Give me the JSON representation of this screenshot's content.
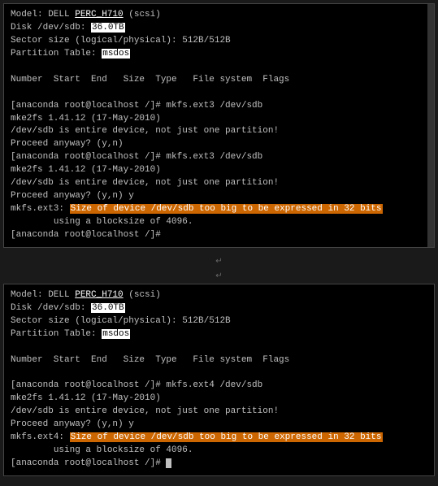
{
  "panels": [
    {
      "id": "panel-top",
      "lines": [
        {
          "id": "l1",
          "parts": [
            {
              "text": "Model: DELL ",
              "style": "text-normal"
            },
            {
              "text": "PERC_H710",
              "style": "text-white underline"
            },
            {
              "text": " (scsi)",
              "style": "text-normal"
            }
          ]
        },
        {
          "id": "l2",
          "parts": [
            {
              "text": "Disk /dev/sdb: ",
              "style": "text-normal"
            },
            {
              "text": "36.0TB",
              "style": "highlight-box"
            }
          ]
        },
        {
          "id": "l3",
          "parts": [
            {
              "text": "Sector size (logical/physical): 512B/512B",
              "style": "text-normal"
            }
          ]
        },
        {
          "id": "l4",
          "parts": [
            {
              "text": "Partition Table: ",
              "style": "text-normal"
            },
            {
              "text": "msdos",
              "style": "highlight-box"
            }
          ]
        },
        {
          "id": "l5",
          "parts": [
            {
              "text": "",
              "style": "text-normal"
            }
          ]
        },
        {
          "id": "l6",
          "parts": [
            {
              "text": "Number  Start  End   Size  Type   File system  Flags",
              "style": "text-normal"
            }
          ]
        },
        {
          "id": "l7",
          "parts": [
            {
              "text": "",
              "style": "text-normal"
            }
          ]
        },
        {
          "id": "l8",
          "parts": [
            {
              "text": "[anaconda root@localhost /]# mkfs.ext3 /dev/sdb",
              "style": "text-normal"
            }
          ]
        },
        {
          "id": "l9",
          "parts": [
            {
              "text": "mke2fs 1.41.12 (17-May-2010)",
              "style": "text-normal"
            }
          ]
        },
        {
          "id": "l10",
          "parts": [
            {
              "text": "/dev/sdb is entire device, not just one partition!",
              "style": "text-normal"
            }
          ]
        },
        {
          "id": "l11",
          "parts": [
            {
              "text": "Proceed anyway? (y,n)",
              "style": "text-normal"
            }
          ]
        },
        {
          "id": "l12",
          "parts": [
            {
              "text": "[anaconda root@localhost /]# mkfs.ext3 /dev/sdb",
              "style": "text-normal"
            }
          ]
        },
        {
          "id": "l13",
          "parts": [
            {
              "text": "mke2fs 1.41.12 (17-May-2010)",
              "style": "text-normal"
            }
          ]
        },
        {
          "id": "l14",
          "parts": [
            {
              "text": "/dev/sdb is entire device, not just one partition!",
              "style": "text-normal"
            }
          ]
        },
        {
          "id": "l15",
          "parts": [
            {
              "text": "Proceed anyway? (y,n) y",
              "style": "text-normal"
            }
          ]
        },
        {
          "id": "l16",
          "parts": [
            {
              "text": "mkfs.ext3: ",
              "style": "text-normal"
            },
            {
              "text": "Size of device /dev/sdb too big to be expressed in 32 bits",
              "style": "highlight-orange"
            }
          ]
        },
        {
          "id": "l17",
          "parts": [
            {
              "text": "        using a blocksize of 4096.",
              "style": "text-normal"
            }
          ]
        },
        {
          "id": "l18",
          "parts": [
            {
              "text": "[anaconda root@localhost /]#",
              "style": "text-normal"
            }
          ]
        }
      ]
    },
    {
      "id": "panel-bottom",
      "lines": [
        {
          "id": "b1",
          "parts": [
            {
              "text": "Model: DELL ",
              "style": "text-normal"
            },
            {
              "text": "PERC_H710",
              "style": "text-white underline"
            },
            {
              "text": " (scsi)",
              "style": "text-normal"
            }
          ]
        },
        {
          "id": "b2",
          "parts": [
            {
              "text": "Disk /dev/sdb: ",
              "style": "text-normal"
            },
            {
              "text": "36.0TB",
              "style": "highlight-box"
            }
          ]
        },
        {
          "id": "b3",
          "parts": [
            {
              "text": "Sector size (logical/physical): 512B/512B",
              "style": "text-normal"
            }
          ]
        },
        {
          "id": "b4",
          "parts": [
            {
              "text": "Partition Table: ",
              "style": "text-normal"
            },
            {
              "text": "msdos",
              "style": "highlight-box"
            }
          ]
        },
        {
          "id": "b5",
          "parts": [
            {
              "text": "",
              "style": "text-normal"
            }
          ]
        },
        {
          "id": "b6",
          "parts": [
            {
              "text": "Number  Start  End   Size  Type   File system  Flags",
              "style": "text-normal"
            }
          ]
        },
        {
          "id": "b7",
          "parts": [
            {
              "text": "",
              "style": "text-normal"
            }
          ]
        },
        {
          "id": "b8",
          "parts": [
            {
              "text": "[anaconda root@localhost /]# mkfs.ext4 /dev/sdb",
              "style": "text-normal"
            }
          ]
        },
        {
          "id": "b9",
          "parts": [
            {
              "text": "mke2fs 1.41.12 (17-May-2010)",
              "style": "text-normal"
            }
          ]
        },
        {
          "id": "b10",
          "parts": [
            {
              "text": "/dev/sdb is entire device, not just one partition!",
              "style": "text-normal"
            }
          ]
        },
        {
          "id": "b11",
          "parts": [
            {
              "text": "Proceed anyway? (y,n) y",
              "style": "text-normal"
            }
          ]
        },
        {
          "id": "b12",
          "parts": [
            {
              "text": "mkfs.ext4: ",
              "style": "text-normal"
            },
            {
              "text": "Size of device /dev/sdb too big to be expressed in 32 bits",
              "style": "highlight-orange"
            }
          ]
        },
        {
          "id": "b13",
          "parts": [
            {
              "text": "        using a blocksize of 4096.",
              "style": "text-normal"
            }
          ]
        },
        {
          "id": "b14",
          "parts": [
            {
              "text": "[anaconda root@localhost /]# ",
              "style": "text-normal"
            },
            {
              "text": "CURSOR",
              "style": "cursor"
            }
          ]
        }
      ]
    }
  ]
}
